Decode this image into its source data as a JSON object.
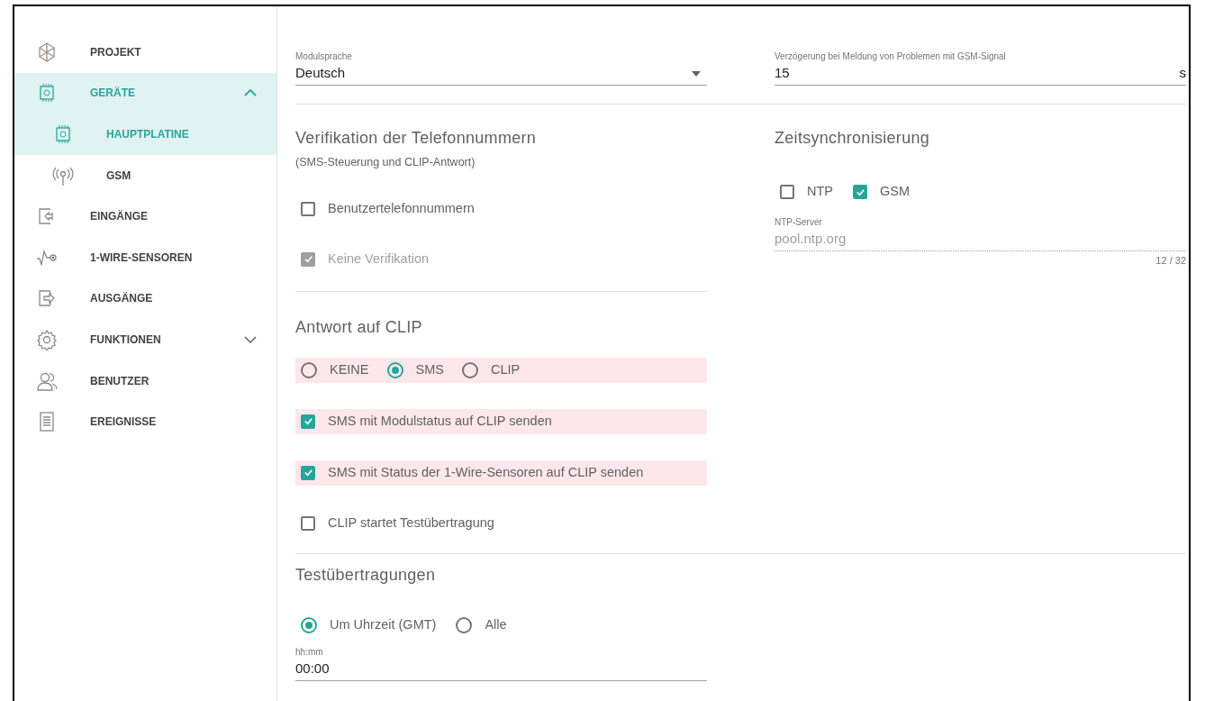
{
  "sidebar": {
    "items": [
      {
        "label": "PROJEKT",
        "selected": false
      },
      {
        "label": "GERÄTE",
        "selected": true,
        "expanded": true,
        "children": [
          {
            "label": "HAUPTPLATINE",
            "selected": true
          },
          {
            "label": "GSM",
            "selected": false
          }
        ]
      },
      {
        "label": "EINGÄNGE",
        "selected": false
      },
      {
        "label": "1-WIRE-SENSOREN",
        "selected": false
      },
      {
        "label": "AUSGÄNGE",
        "selected": false
      },
      {
        "label": "FUNKTIONEN",
        "selected": false,
        "expanded": false
      },
      {
        "label": "BENUTZER",
        "selected": false
      },
      {
        "label": "EREIGNISSE",
        "selected": false
      }
    ]
  },
  "language_field": {
    "label": "Modulsprache",
    "value": "Deutsch"
  },
  "delay_field": {
    "label": "Verzögerung bei Meldung von Problemen mit GSM-Signal",
    "value": "15",
    "unit": "s"
  },
  "phone_verification": {
    "title": "Verifikation der Telefonnummern",
    "subtitle": "(SMS-Steuerung und CLIP-Antwort)",
    "options": [
      {
        "label": "Benutzertelefonnummern",
        "checked": false
      },
      {
        "label": "Keine Verifikation",
        "checked": true,
        "disabled": true
      }
    ]
  },
  "clip_response": {
    "title": "Antwort auf CLIP",
    "choices": {
      "highlighted": true,
      "options": [
        {
          "label": "KEINE",
          "selected": false
        },
        {
          "label": "SMS",
          "selected": true
        },
        {
          "label": "CLIP",
          "selected": false
        }
      ]
    },
    "checkboxes": [
      {
        "label": "SMS mit Modulstatus auf CLIP senden",
        "checked": true,
        "highlighted": true
      },
      {
        "label": "SMS mit Status der 1-Wire-Sensoren auf CLIP senden",
        "checked": true,
        "highlighted": true
      },
      {
        "label": "CLIP startet Testübertragung",
        "checked": false,
        "highlighted": false
      }
    ]
  },
  "time_sync": {
    "title": "Zeitsynchronisierung",
    "options": [
      {
        "label": "NTP",
        "checked": false
      },
      {
        "label": "GSM",
        "checked": true
      }
    ],
    "server_field": {
      "label": "NTP-Server",
      "value": "pool.ntp.org",
      "counter": "12 / 32",
      "disabled": true
    }
  },
  "test_transmissions": {
    "title": "Testübertragungen",
    "options": [
      {
        "label": "Um Uhrzeit (GMT)",
        "selected": true
      },
      {
        "label": "Alle",
        "selected": false
      }
    ],
    "time_field": {
      "label": "hh:mm",
      "value": "00:00"
    }
  }
}
